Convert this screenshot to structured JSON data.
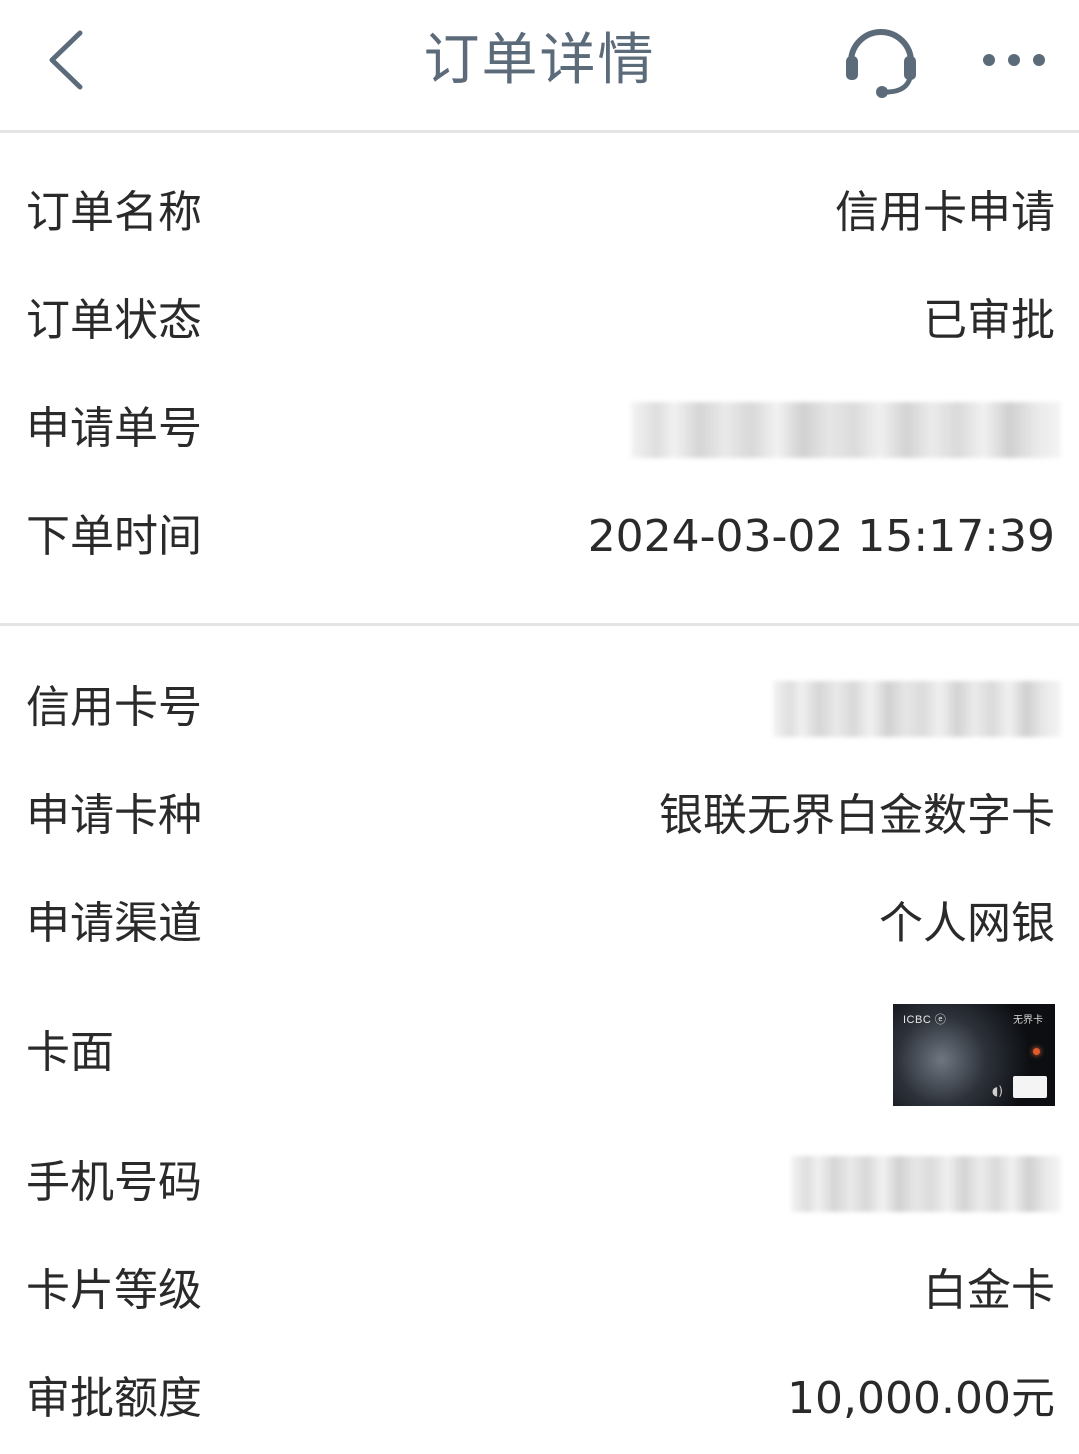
{
  "header": {
    "title": "订单详情"
  },
  "section1": {
    "rows": [
      {
        "label": "订单名称",
        "value": "信用卡申请"
      },
      {
        "label": "订单状态",
        "value": "已审批"
      },
      {
        "label": "申请单号",
        "value": ""
      },
      {
        "label": "下单时间",
        "value": "2024-03-02 15:17:39"
      }
    ]
  },
  "section2": {
    "rows": [
      {
        "label": "信用卡号",
        "value": ""
      },
      {
        "label": "申请卡种",
        "value": "银联无界白金数字卡"
      },
      {
        "label": "申请渠道",
        "value": "个人网银"
      },
      {
        "label": "卡面",
        "value": ""
      },
      {
        "label": "手机号码",
        "value": ""
      },
      {
        "label": "卡片等级",
        "value": "白金卡"
      },
      {
        "label": "审批额度",
        "value": "10,000.00元"
      }
    ]
  },
  "card": {
    "logo_text": "ICBC ⓔ",
    "name_text": "无界卡"
  },
  "icons": {
    "back": "chevron-left-icon",
    "service": "headset-icon",
    "more": "more-dots-icon"
  },
  "colors": {
    "title": "#5c6b7a",
    "text": "#2a2a2a",
    "divider": "#e4e4e4"
  }
}
